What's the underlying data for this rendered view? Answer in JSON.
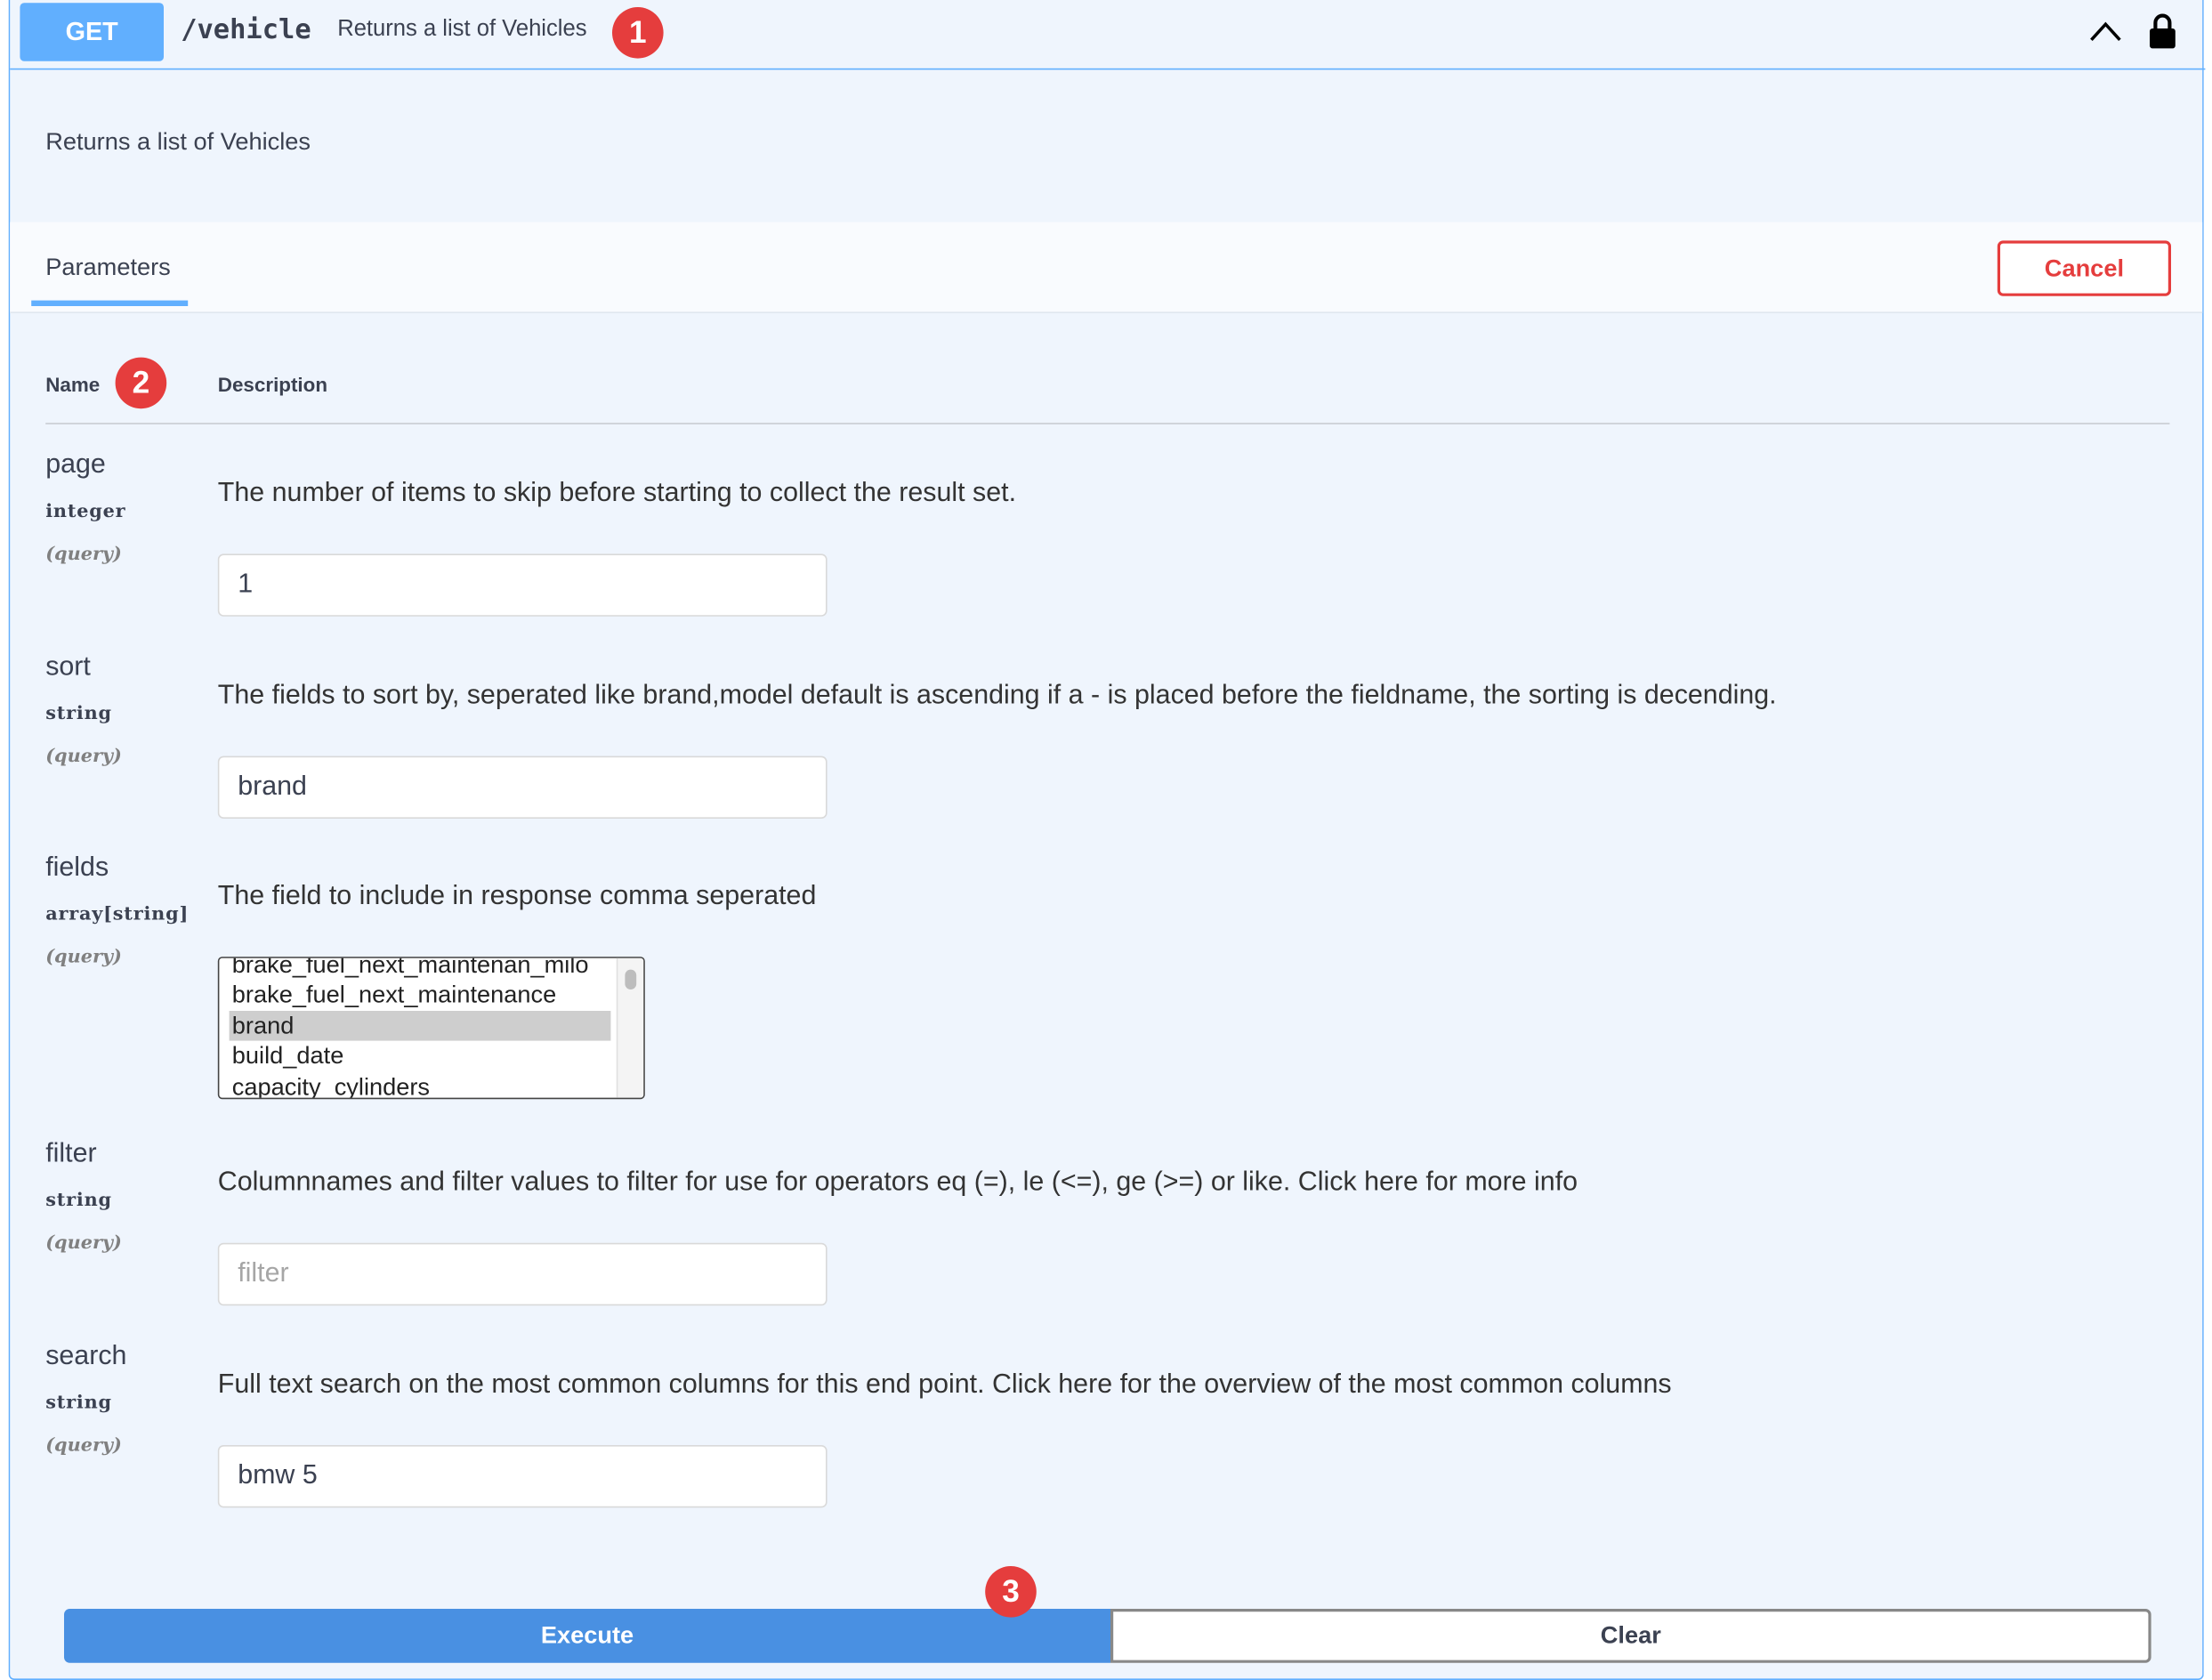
{
  "operation": {
    "method": "GET",
    "path": "/vehicle",
    "summary": "Returns a list of Vehicles",
    "description": "Returns a list of Vehicles"
  },
  "badges": {
    "one": "1",
    "two": "2",
    "three": "3"
  },
  "tabs": {
    "parameters": "Parameters",
    "cancel": "Cancel"
  },
  "table": {
    "name_header": "Name",
    "description_header": "Description"
  },
  "params": [
    {
      "name": "page",
      "type": "integer",
      "in": "(query)",
      "description": "The number of items to skip before starting to collect the result set.",
      "value": "1",
      "placeholder": ""
    },
    {
      "name": "sort",
      "type": "string",
      "in": "(query)",
      "description": "The fields to sort by, seperated like brand,model default is ascending if a - is placed before the fieldname, the sorting is decending.",
      "value": "brand",
      "placeholder": ""
    },
    {
      "name": "fields",
      "type": "array[string]",
      "in": "(query)",
      "description": "The field to include in response comma seperated",
      "options": [
        "brake_fuel_next_maintenan_milo",
        "brake_fuel_next_maintenance",
        "brand",
        "build_date",
        "capacity_cylinders"
      ],
      "selected": "brand"
    },
    {
      "name": "filter",
      "type": "string",
      "in": "(query)",
      "description": "Columnnames and filter values to filter for use for operators eq (=), le (<=), ge (>=) or like. Click here for more info",
      "value": "",
      "placeholder": "filter"
    },
    {
      "name": "search",
      "type": "string",
      "in": "(query)",
      "description": "Full text search on the most common columns for this end point. Click here for the overview of the most common columns",
      "value": "bmw 5",
      "placeholder": ""
    }
  ],
  "actions": {
    "execute": "Execute",
    "clear": "Clear"
  },
  "colors": {
    "get": "#61affe",
    "execute": "#4990e2",
    "cancel": "#e53d3d",
    "badge": "#e53d3d",
    "panel": "#eff5fd"
  },
  "icons": {
    "collapse": "chevron-up-icon",
    "lock": "lock-icon"
  }
}
